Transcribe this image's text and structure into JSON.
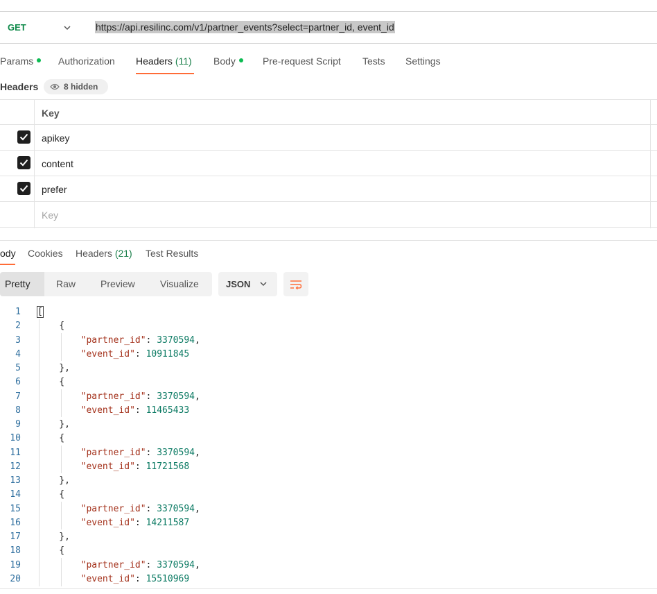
{
  "request": {
    "method": "GET",
    "url": "https://api.resilinc.com/v1/partner_events?select=partner_id, event_id"
  },
  "request_tabs": [
    {
      "label": "Params",
      "dot": true
    },
    {
      "label": "Authorization"
    },
    {
      "label": "Headers ",
      "count": "(11)",
      "active": true
    },
    {
      "label": "Body",
      "dot": true
    },
    {
      "label": "Pre-request Script"
    },
    {
      "label": "Tests"
    },
    {
      "label": "Settings"
    }
  ],
  "headers_section": {
    "title": "Headers",
    "hidden_label": "8 hidden"
  },
  "headers_table": {
    "column": "Key",
    "rows": [
      {
        "key": "apikey",
        "checked": true
      },
      {
        "key": "content",
        "checked": true
      },
      {
        "key": "prefer",
        "checked": true
      }
    ],
    "placeholder": "Key"
  },
  "response_tabs": [
    {
      "label": "ody",
      "active": true
    },
    {
      "label": "Cookies"
    },
    {
      "label": "Headers ",
      "count": "(21)"
    },
    {
      "label": "Test Results"
    }
  ],
  "view_modes": [
    "Pretty",
    "Raw",
    "Preview",
    "Visualize"
  ],
  "active_view": "Pretty",
  "format": "JSON",
  "code_lines": [
    {
      "no": "1",
      "text": "["
    },
    {
      "no": "2",
      "text": "    {"
    },
    {
      "no": "3",
      "key": "partner_id",
      "value": "3370594",
      "comma": true
    },
    {
      "no": "4",
      "key": "event_id",
      "value": "10911845"
    },
    {
      "no": "5",
      "text": "    },"
    },
    {
      "no": "6",
      "text": "    {"
    },
    {
      "no": "7",
      "key": "partner_id",
      "value": "3370594",
      "comma": true
    },
    {
      "no": "8",
      "key": "event_id",
      "value": "11465433"
    },
    {
      "no": "9",
      "text": "    },"
    },
    {
      "no": "10",
      "text": "    {"
    },
    {
      "no": "11",
      "key": "partner_id",
      "value": "3370594",
      "comma": true
    },
    {
      "no": "12",
      "key": "event_id",
      "value": "11721568"
    },
    {
      "no": "13",
      "text": "    },"
    },
    {
      "no": "14",
      "text": "    {"
    },
    {
      "no": "15",
      "key": "partner_id",
      "value": "3370594",
      "comma": true
    },
    {
      "no": "16",
      "key": "event_id",
      "value": "14211587"
    },
    {
      "no": "17",
      "text": "    },"
    },
    {
      "no": "18",
      "text": "    {"
    },
    {
      "no": "19",
      "key": "partner_id",
      "value": "3370594",
      "comma": true
    },
    {
      "no": "20",
      "key": "event_id",
      "value": "15510969"
    }
  ],
  "colors": {
    "accent": "#ff6c37",
    "method": "#0f8a4a",
    "json_key": "#a3301a",
    "json_number": "#0b7a63",
    "status_dot": "#0cbb52"
  }
}
